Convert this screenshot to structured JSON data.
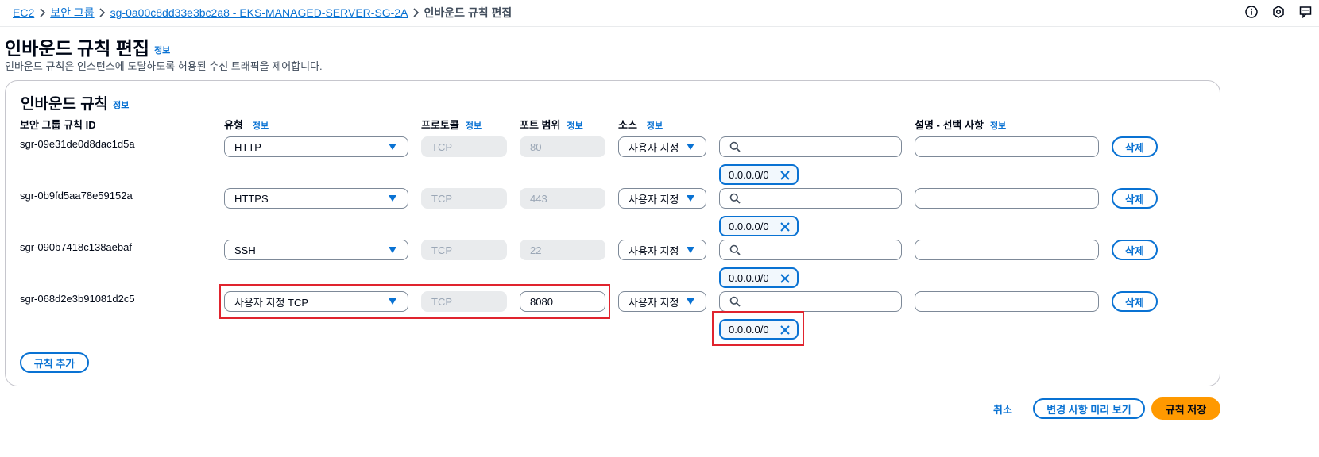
{
  "breadcrumb": {
    "items": [
      "EC2",
      "보안 그룹",
      "sg-0a00c8dd33e3bc2a8 - EKS-MANAGED-SERVER-SG-2A"
    ],
    "current": "인바운드 규칙 편집"
  },
  "top_icons": [
    "info-circle-icon",
    "settings-gear-icon",
    "feedback-icon"
  ],
  "page": {
    "title": "인바운드 규칙 편집",
    "info": "정보",
    "description": "인바운드 규칙은 인스턴스에 도달하도록 허용된 수신 트래픽을 제어합니다."
  },
  "container": {
    "title": "인바운드 규칙",
    "info": "정보",
    "columns": {
      "rule_id": "보안 그룹 규칙 ID",
      "type": "유형",
      "protocol": "프로토콜",
      "port_range": "포트 범위",
      "source": "소스",
      "description": "설명 - 선택 사항",
      "info": "정보"
    }
  },
  "rules": [
    {
      "id": "sgr-09e31de0d8dac1d5a",
      "type": "HTTP",
      "protocol": "TCP",
      "port": "80",
      "source_type": "사용자 지정",
      "source_token": "0.0.0.0/0",
      "delete": "삭제"
    },
    {
      "id": "sgr-0b9fd5aa78e59152a",
      "type": "HTTPS",
      "protocol": "TCP",
      "port": "443",
      "source_type": "사용자 지정",
      "source_token": "0.0.0.0/0",
      "delete": "삭제"
    },
    {
      "id": "sgr-090b7418c138aebaf",
      "type": "SSH",
      "protocol": "TCP",
      "port": "22",
      "source_type": "사용자 지정",
      "source_token": "0.0.0.0/0",
      "delete": "삭제"
    },
    {
      "id": "sgr-068d2e3b91081d2c5",
      "type": "사용자 지정 TCP",
      "protocol": "TCP",
      "port": "8080",
      "source_type": "사용자 지정",
      "source_token": "0.0.0.0/0",
      "delete": "삭제"
    }
  ],
  "add_rule": "규칙 추가",
  "footer": {
    "cancel": "취소",
    "preview": "변경 사항 미리 보기",
    "save": "규칙 저장"
  },
  "colors": {
    "accent": "#0972d3",
    "primary_button": "#ff9900",
    "highlight": "#e0242e"
  }
}
